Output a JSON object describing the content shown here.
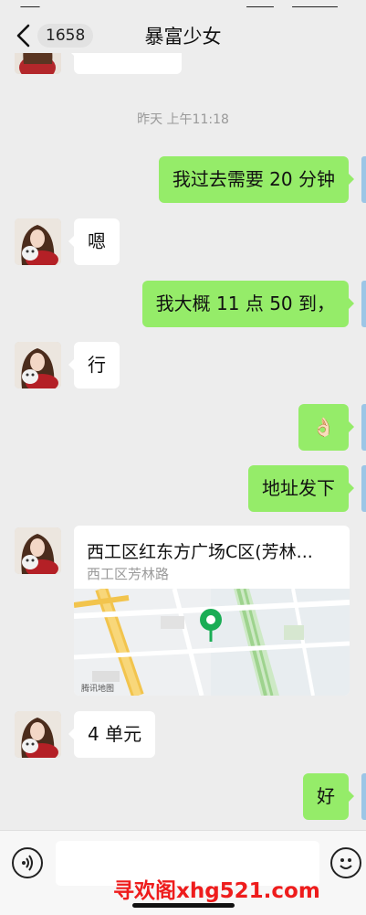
{
  "header": {
    "unread_count": "1658",
    "title": "暴富少女"
  },
  "chat": {
    "timestamp": "昨天 上午11:18",
    "messages": [
      {
        "side": "out",
        "text": "我过去需要 20 分钟"
      },
      {
        "side": "in",
        "text": "嗯"
      },
      {
        "side": "out",
        "text": "我大概 11 点 50 到，"
      },
      {
        "side": "in",
        "text": "行"
      },
      {
        "side": "out",
        "text": "👌🏻"
      },
      {
        "side": "out",
        "text": "地址发下"
      },
      {
        "side": "in",
        "text": "4 单元"
      },
      {
        "side": "out",
        "text": "好"
      }
    ],
    "location": {
      "title": "西工区红东方广场C区(芳林...",
      "address": "西工区芳林路",
      "map_brand": "腾讯地图"
    }
  },
  "input": {
    "placeholder": ""
  },
  "watermark": "寻欢阁xhg521.com",
  "colors": {
    "background": "#ededed",
    "out_bubble": "#95ec69",
    "in_bubble": "#ffffff",
    "watermark": "#ee1c1c",
    "map_pin": "#1aad55"
  }
}
